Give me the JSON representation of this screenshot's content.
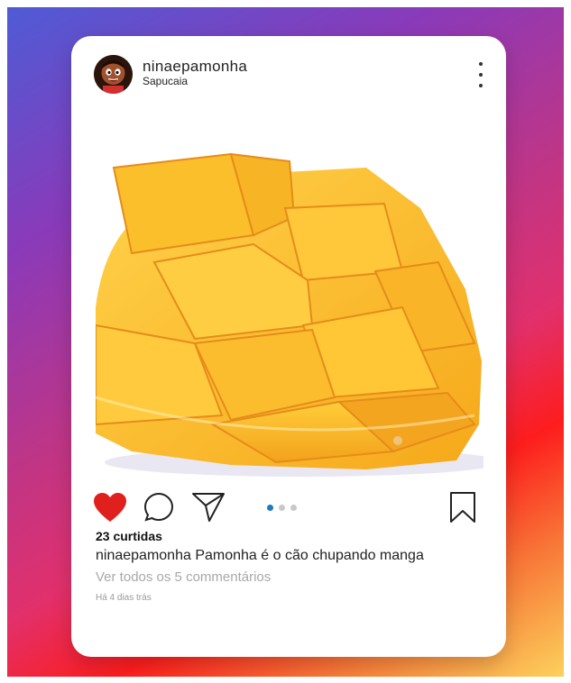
{
  "post": {
    "username": "ninaepamonha",
    "location": "Sapucaia",
    "likes": "23 curtidas",
    "caption_user": "ninaepamonha",
    "caption_text": "Pamonha é o cão chupando manga",
    "view_comments": "Ver todos os 5 commentários",
    "timestamp": "Há 4 dias trás",
    "liked": true,
    "carousel_total": 3,
    "carousel_active": 1
  },
  "colors": {
    "like": "#e0201d",
    "carousel_active": "#1d7bc4",
    "carousel_inactive": "#c9c9c9",
    "gradient": [
      "#4f5bd5",
      "#8a3ab9",
      "#c13584",
      "#e1306c",
      "#fd1d1d",
      "#f77737",
      "#fcd15c"
    ]
  },
  "icons": [
    "like-heart-icon",
    "comment-bubble-icon",
    "share-paper-plane-icon",
    "bookmark-icon",
    "more-options-icon"
  ]
}
